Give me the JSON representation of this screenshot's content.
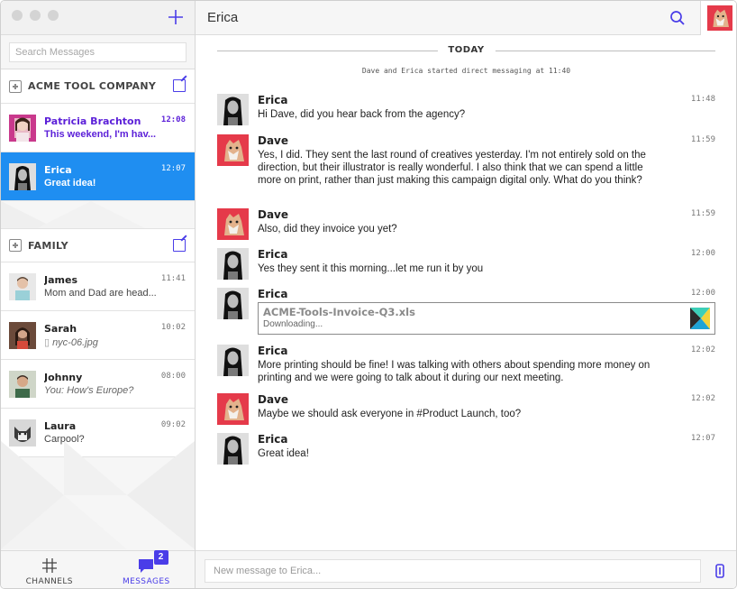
{
  "sidebar": {
    "add_icon": "plus-icon",
    "search_placeholder": "Search Messages",
    "groups": [
      {
        "name": "ACME TOOL COMPANY",
        "conversations": [
          {
            "name": "Patricia Brachton",
            "preview": "This weekend, I'm hav...",
            "time": "12:08",
            "unread": true
          },
          {
            "name": "Erica",
            "preview": "Great idea!",
            "time": "12:07",
            "selected": true
          }
        ]
      },
      {
        "name": "FAMILY",
        "conversations": [
          {
            "name": "James",
            "preview": "Mom and Dad are head...",
            "time": "11:41"
          },
          {
            "name": "Sarah",
            "preview": "nyc-06.jpg",
            "time": "10:02"
          },
          {
            "name": "Johnny",
            "preview": "You: How's Europe?",
            "time": "08:00"
          },
          {
            "name": "Laura",
            "preview": "Carpool?",
            "time": "09:02"
          }
        ]
      }
    ],
    "nav": {
      "channels_label": "CHANNELS",
      "messages_label": "MESSAGES",
      "messages_badge": "2"
    }
  },
  "chat": {
    "title": "Erica",
    "day_divider": "TODAY",
    "system_message": "Dave and Erica started direct messaging at 11:40",
    "messages": [
      {
        "author": "Erica",
        "time": "11:48",
        "text": "Hi Dave, did you hear back from the agency?"
      },
      {
        "author": "Dave",
        "time": "11:59",
        "text": "Yes, I did. They sent the last round of creatives yesterday. I'm not entirely sold on the direction, but their illustrator is really wonderful. I also think that we can spend a little more on print, rather than just making this campaign digital only. What do you think?"
      },
      {
        "author": "Dave",
        "time": "11:59",
        "text": "Also, did they invoice you yet?"
      },
      {
        "author": "Erica",
        "time": "12:00",
        "text": "Yes they sent it this morning...let me run it by you"
      },
      {
        "author": "Erica",
        "time": "12:00",
        "file_name": "ACME-Tools-Invoice-Q3.xls",
        "file_status": "Downloading..."
      },
      {
        "author": "Erica",
        "time": "12:02",
        "text": "More printing should be fine! I was talking with others about spending more money on printing and we were going to talk about it during our next meeting."
      },
      {
        "author": "Dave",
        "time": "12:02",
        "text": "Maybe we should ask everyone in #Product Launch, too?"
      },
      {
        "author": "Erica",
        "time": "12:07",
        "text": "Great idea!"
      }
    ],
    "composer_placeholder": "New message to Erica..."
  },
  "colors": {
    "accent": "#4a3de8",
    "selected": "#1f8ef1",
    "unread": "#5b1fd8"
  }
}
